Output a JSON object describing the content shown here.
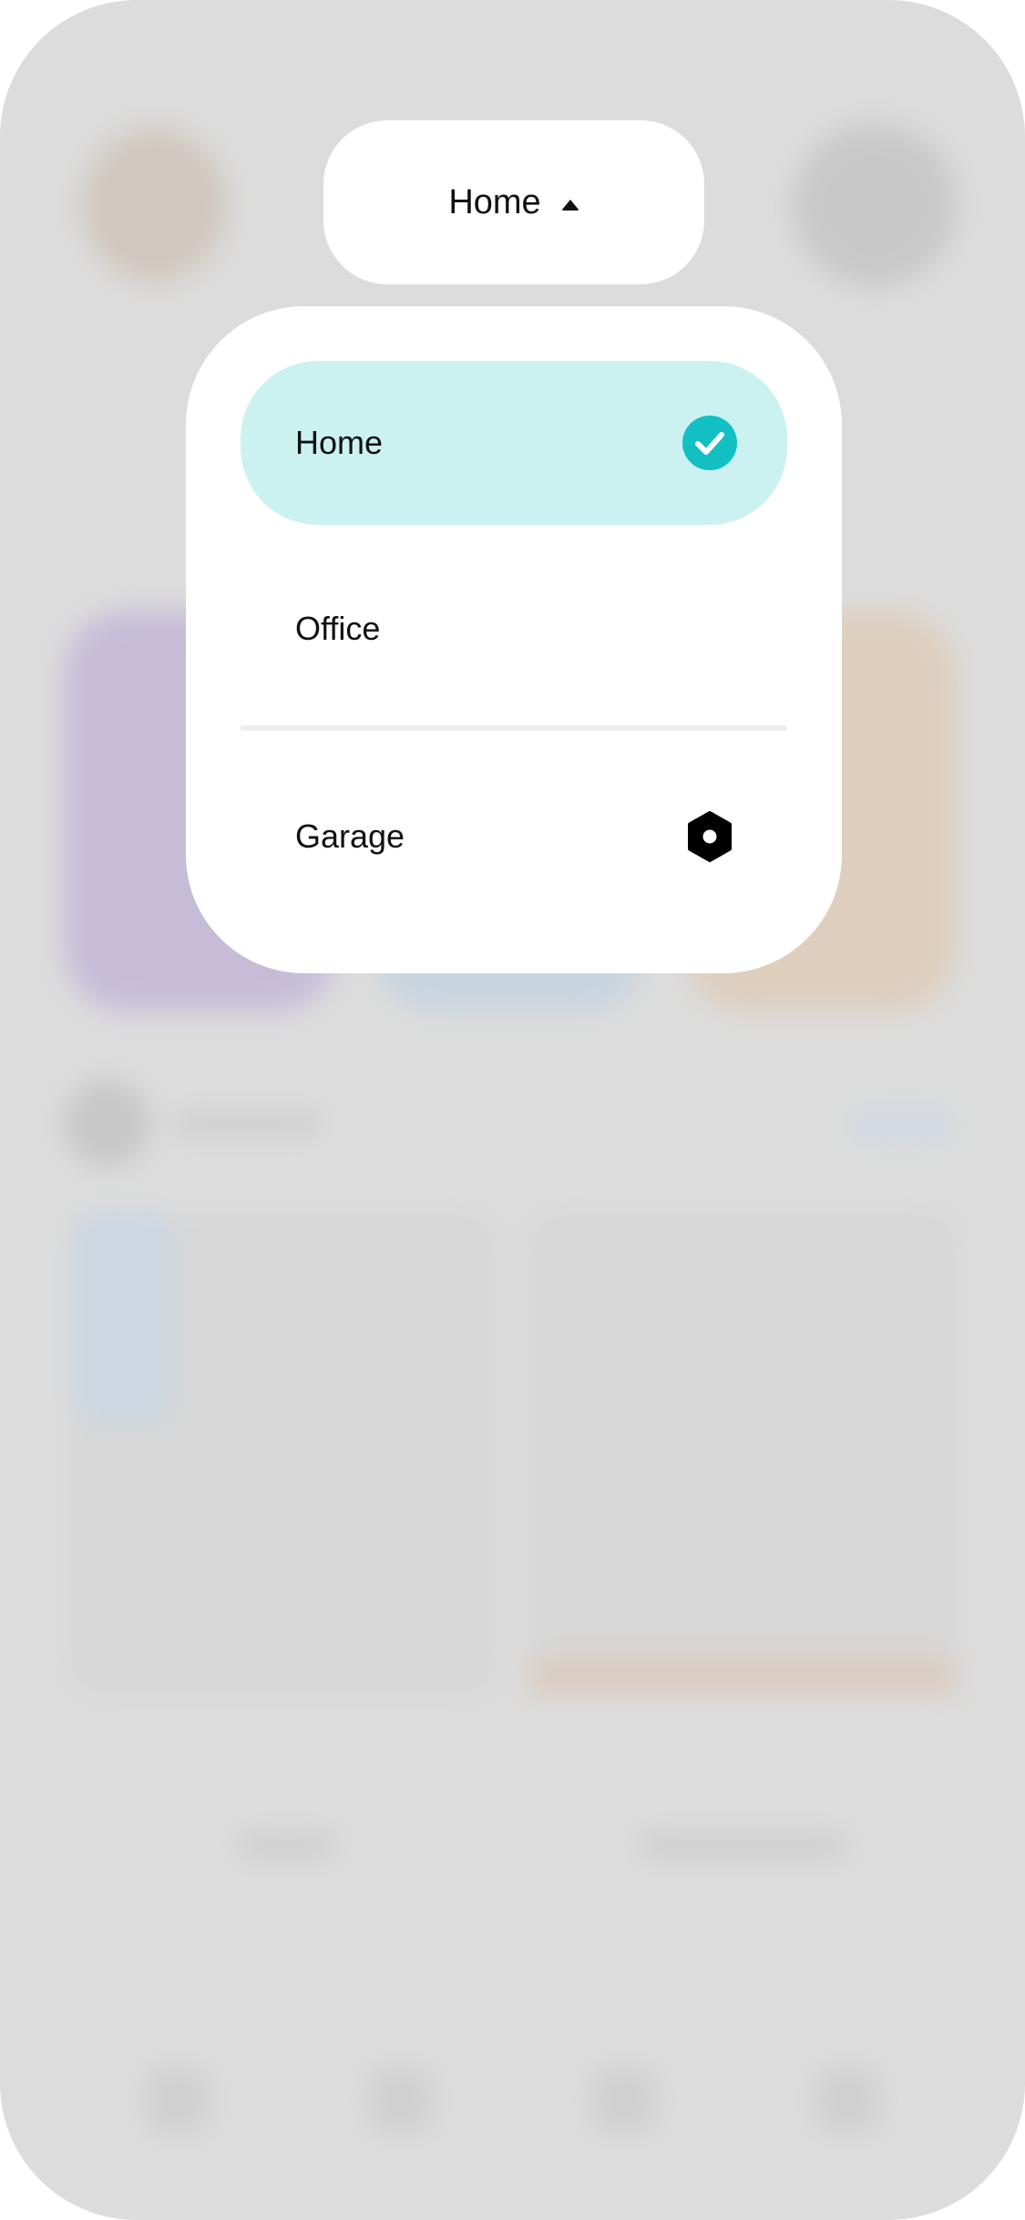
{
  "header": {
    "selected_location": "Home"
  },
  "location_menu": {
    "items": [
      {
        "label": "Home",
        "selected": true,
        "icon": "check-circle-icon"
      },
      {
        "label": "Office",
        "selected": false,
        "icon": ""
      },
      {
        "label": "Garage",
        "selected": false,
        "icon": "hexagon-nut-icon"
      }
    ]
  },
  "colors": {
    "accent": "#12c0c3",
    "selected_bg": "#ccf1f1",
    "overlay": "#dcdcdc"
  }
}
